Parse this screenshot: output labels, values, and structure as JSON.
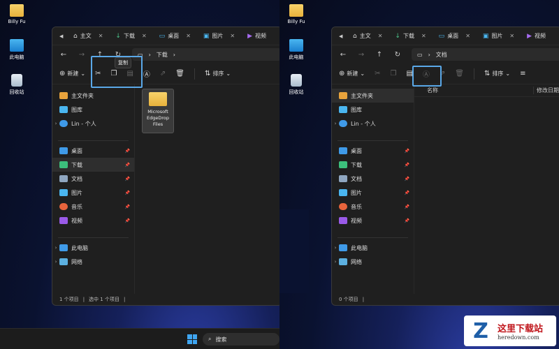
{
  "desktop": {
    "icons": [
      {
        "label": "Billy Fu"
      },
      {
        "label": "此电脑"
      },
      {
        "label": "回收站"
      }
    ]
  },
  "left": {
    "tabs": [
      {
        "label": "主文"
      },
      {
        "label": "下载"
      },
      {
        "label": "桌面"
      },
      {
        "label": "图片"
      },
      {
        "label": "视频"
      }
    ],
    "path": "下载",
    "toolbar": {
      "new_label": "新建",
      "sort_label": "排序"
    },
    "tooltip": "复制",
    "file": {
      "name": "Microsoft EdgeDrop Files"
    },
    "status_count": "1 个项目",
    "status_selected": "选中 1 个项目"
  },
  "right": {
    "tabs": [
      {
        "label": "主文"
      },
      {
        "label": "下载"
      },
      {
        "label": "桌面"
      },
      {
        "label": "图片"
      },
      {
        "label": "视频"
      }
    ],
    "path": "文档",
    "toolbar": {
      "new_label": "新建",
      "sort_label": "排序"
    },
    "columns": {
      "name": "名称",
      "modified": "修改日期"
    },
    "status_count": "0 个项目"
  },
  "sidebar": {
    "home": "主文件夹",
    "gallery": "图库",
    "onedrive": "Lin - 个人",
    "desktop": "桌面",
    "downloads": "下载",
    "documents": "文档",
    "pictures": "图片",
    "music": "音乐",
    "videos": "视频",
    "thispc": "此电脑",
    "network": "网络"
  },
  "taskbar": {
    "search_label": "搜索"
  },
  "watermark": {
    "title": "这里下载站",
    "domain": "heredown.com"
  }
}
